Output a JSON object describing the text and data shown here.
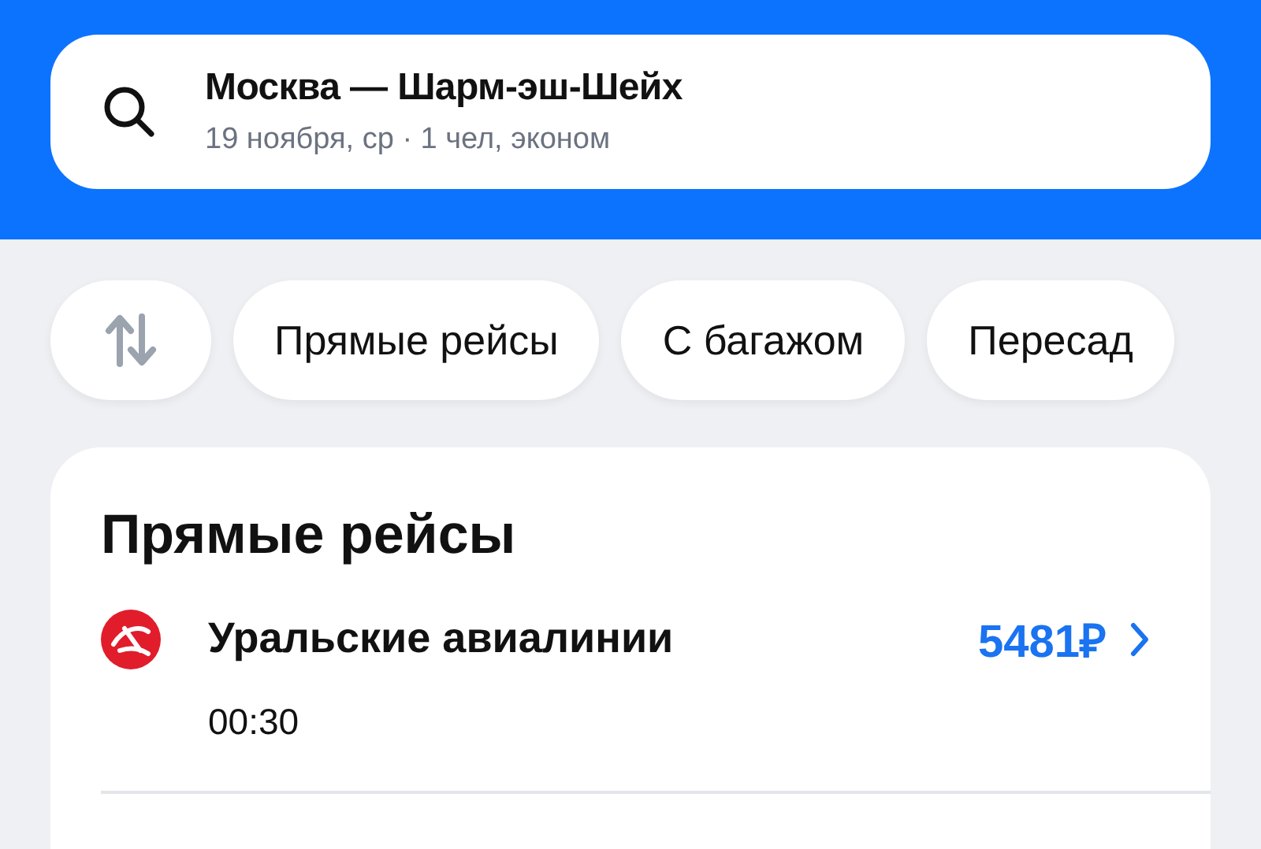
{
  "search": {
    "route": "Москва — Шарм-эш-Шейх",
    "details": "19 ноября, ср · 1 чел, эконом"
  },
  "filters": [
    "Прямые рейсы",
    "С багажом",
    "Пересад"
  ],
  "section": {
    "title": "Прямые рейсы",
    "flights": [
      {
        "airline": "Уральские авиалинии",
        "price": "5481₽",
        "time": "00:30"
      }
    ]
  }
}
